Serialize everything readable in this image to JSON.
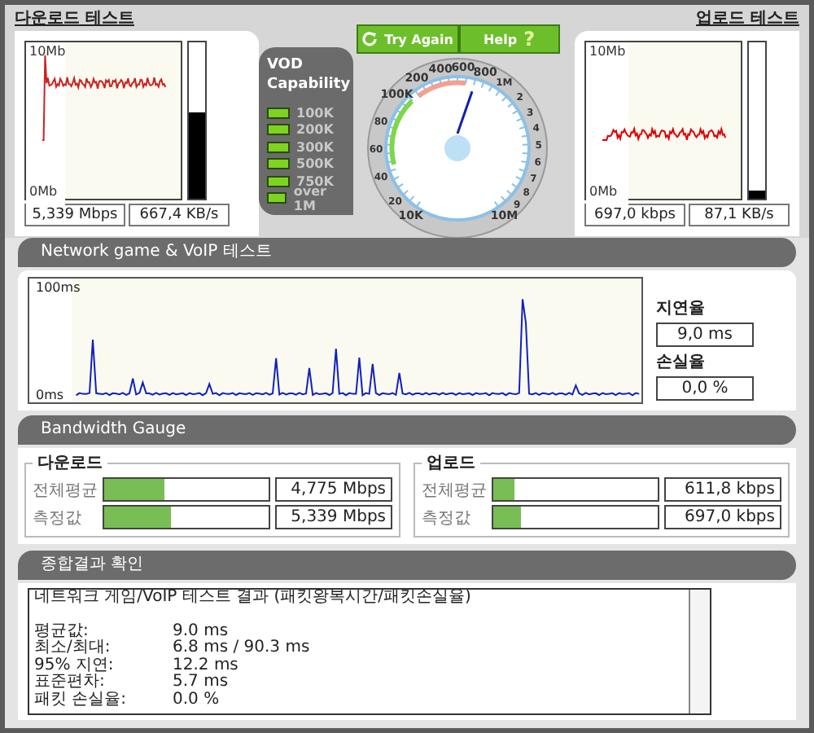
{
  "download_test": {
    "title": "다운로드 테스트",
    "axis_top": "10Mb",
    "axis_bottom": "0Mb",
    "level": 0.55,
    "readings": [
      "5,339 Mbps",
      "667,4 KB/s"
    ]
  },
  "vod": {
    "title": "VOD Capability",
    "items": [
      {
        "label": "100K",
        "on": true
      },
      {
        "label": "200K",
        "on": true
      },
      {
        "label": "300K",
        "on": true
      },
      {
        "label": "500K",
        "on": true
      },
      {
        "label": "750K",
        "on": true
      },
      {
        "label": "over 1M",
        "on": true
      }
    ]
  },
  "buttons": [
    {
      "label": "Try Again",
      "kind": "refresh"
    },
    {
      "label": "Help",
      "kind": "help",
      "icon": "?"
    }
  ],
  "dial": {
    "labels": [
      "10K",
      "20",
      "40",
      "60",
      "80",
      "100K",
      "200",
      "400",
      "600",
      "800",
      "1M",
      "2",
      "3",
      "4",
      "5",
      "6",
      "7",
      "8",
      "9",
      "10M"
    ]
  },
  "upload_test": {
    "title": "업로드 테스트",
    "axis_top": "10Mb",
    "axis_bottom": "0Mb",
    "level": 0.05,
    "readings": [
      "697,0 kbps",
      "87,1 KB/s"
    ]
  },
  "network_test": {
    "title": "Network game & VoIP 테스트",
    "axis_top": "100ms",
    "axis_bottom": "0ms",
    "latency_label": "지연율",
    "latency": "9,0 ms",
    "loss_label": "손실율",
    "loss": "0,0 %"
  },
  "bandwidth_gauge": {
    "title": "Bandwidth Gauge",
    "groups": [
      {
        "title": "다운로드",
        "rows": [
          {
            "label": "전체평균",
            "level": 0.37,
            "value": "4,775 Mbps"
          },
          {
            "label": "측정값",
            "level": 0.41,
            "value": "5,339 Mbps"
          }
        ]
      },
      {
        "title": "업로드",
        "rows": [
          {
            "label": "전체평균",
            "level": 0.13,
            "value": "611,8 kbps"
          },
          {
            "label": "측정값",
            "level": 0.17,
            "value": "697,0 kbps"
          }
        ]
      }
    ]
  },
  "summary": {
    "title": "종합결과 확인",
    "heading": "네트워크 게임/VoIP 테스트 결과 (패킷왕복시간/패킷손실율)",
    "rows": [
      {
        "label": "평균값:",
        "value": "9.0 ms"
      },
      {
        "label": "최소/최대:",
        "value": "6.8 ms / 90.3 ms"
      },
      {
        "label": "95% 지연:",
        "value": "12.2 ms"
      },
      {
        "label": "표준편차:",
        "value": "5.7 ms"
      },
      {
        "label": "패킷 손실율:",
        "value": "0.0 %"
      }
    ]
  }
}
